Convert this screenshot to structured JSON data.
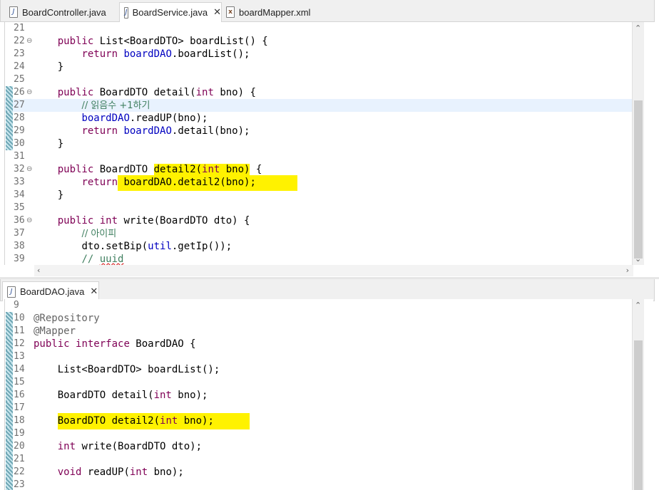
{
  "top_tabs": [
    {
      "label": "BoardController.java",
      "icon": "java-file-icon"
    },
    {
      "label": "BoardService.java",
      "icon": "java-file-icon",
      "close": "✕"
    },
    {
      "label": "boardMapper.xml",
      "icon": "xml-file-icon"
    }
  ],
  "bottom_tabs": [
    {
      "label": "BoardDAO.java",
      "icon": "java-file-icon",
      "close": "✕"
    }
  ],
  "top_code": {
    "l21": "21",
    "l22": "22",
    "l23": "23",
    "l24": "24",
    "l25": "25",
    "l26": "26",
    "l27": "27",
    "l28": "28",
    "l29": "29",
    "l30": "30",
    "l31": "31",
    "l32": "32",
    "l33": "33",
    "l34": "34",
    "l35": "35",
    "l36": "36",
    "l37": "37",
    "l38": "38",
    "l39": "39",
    "public": "public",
    "return": "return",
    "int": "int",
    "boardList_sig": " List<BoardDTO> boardList() {",
    "boardDAO": "boardDAO",
    "boardList_call": ".boardList();",
    "close_brace": "}",
    "detail_sig_a": " BoardDTO detail(",
    "detail_sig_b": " bno) {",
    "comment_read": "// 읽음수 +1하기",
    "readup_call": ".readUP(bno);",
    "detail_call": ".detail(bno);",
    "detail2_sig_a": " BoardDTO ",
    "detail2_hl_a": "detail2(",
    "detail2_hl_b": " bno)",
    "detail2_sig_b": " {",
    "detail2_return_hl": " boardDAO.detail2(bno);",
    "write_sig_a": " write(BoardDTO dto) {",
    "comment_ip": "// 아이피",
    "setbip_a": "dto.setBip(",
    "util": "util",
    "setbip_b": ".getIp());",
    "comment_uuid_a": "// ",
    "comment_uuid_b": "uuid"
  },
  "bottom_code": {
    "l9": "9",
    "l10": "10",
    "l11": "11",
    "l12": "12",
    "l13": "13",
    "l14": "14",
    "l15": "15",
    "l16": "16",
    "l17": "17",
    "l18": "18",
    "l19": "19",
    "l20": "20",
    "l21": "21",
    "l22": "22",
    "l23": "23",
    "repository": "@Repository",
    "mapper": "@Mapper",
    "public": "public",
    "interface": "interface",
    "int": "int",
    "void": "void",
    "iface_name": " BoardDAO {",
    "boardList": "List<BoardDTO> boardList();",
    "detail_a": "BoardDTO detail(",
    "detail_b": " bno);",
    "detail2_a": "BoardDTO detail2(",
    "detail2_b": " bno);",
    "write_b": " write(BoardDTO dto);",
    "readup_b": " readUP(",
    "readup_c": " bno);"
  },
  "colors": {
    "keyword": "#7f0055",
    "field": "#0000c0",
    "comment": "#3f7f5f",
    "highlight": "#fff200",
    "current_line": "#e8f2fe"
  }
}
